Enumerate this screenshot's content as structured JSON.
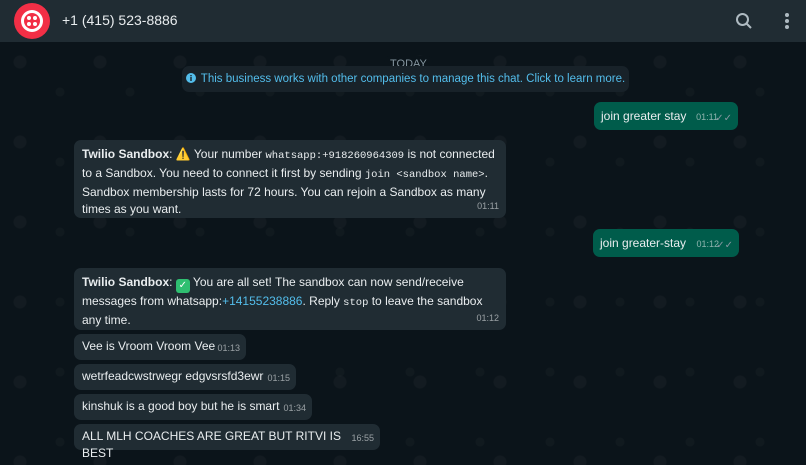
{
  "header": {
    "contact_name": "+1 (415) 523-8886",
    "avatar_color": "#f22f46",
    "icons": [
      "search-icon",
      "more-vertical-icon"
    ]
  },
  "chat": {
    "date_divider": "TODAY",
    "system_notice": "This business works with other companies to manage this chat. Click to learn more.",
    "messages": [
      {
        "direction": "outgoing",
        "text": "join greater stay",
        "time": "01:11",
        "status": "read"
      },
      {
        "direction": "incoming",
        "sender": "Twilio Sandbox",
        "prefix_icon": "warning-emoji",
        "text_parts": [
          "Your number ",
          "whatsapp:+918260964309",
          " is not connected to a Sandbox. You need to connect it first by sending ",
          "join <sandbox name>",
          ". Sandbox membership lasts for 72 hours. You can rejoin a Sandbox as many times as you want."
        ],
        "time": "01:11"
      },
      {
        "direction": "outgoing",
        "text": "join greater-stay",
        "time": "01:12",
        "status": "read"
      },
      {
        "direction": "incoming",
        "sender": "Twilio Sandbox",
        "prefix_icon": "check-emoji",
        "text_parts": [
          "You are all set! The sandbox can now send/receive messages from whatsapp:",
          "+14155238886",
          ". Reply ",
          "stop",
          " to leave the sandbox any time."
        ],
        "time": "01:12"
      },
      {
        "direction": "incoming",
        "text": "Vee is Vroom Vroom Vee",
        "time": "01:13"
      },
      {
        "direction": "incoming",
        "text": "wetrfeadcwstrwegr edgvsrsfd3ewr",
        "time": "01:15"
      },
      {
        "direction": "incoming",
        "text": "kinshuk is a good boy but he is smart",
        "time": "01:34"
      },
      {
        "direction": "incoming",
        "text": "ALL MLH COACHES ARE GREAT BUT RITVI IS BEST",
        "time": "16:55"
      }
    ]
  },
  "colors": {
    "background": "#0b141a",
    "header": "#202c33",
    "incoming": "#202c33",
    "outgoing": "#005c4b",
    "link": "#53bdeb"
  }
}
